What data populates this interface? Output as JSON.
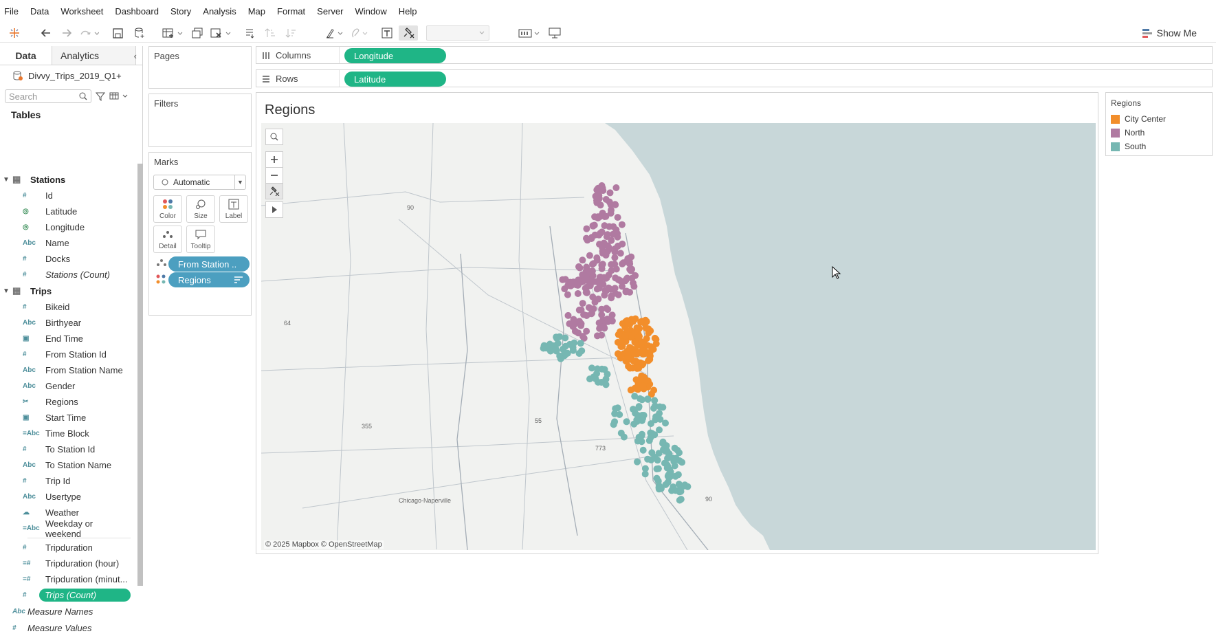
{
  "menu": [
    "File",
    "Data",
    "Worksheet",
    "Dashboard",
    "Story",
    "Analysis",
    "Map",
    "Format",
    "Server",
    "Window",
    "Help"
  ],
  "toolbar": {
    "show_me": "Show Me"
  },
  "datapane": {
    "tab_data": "Data",
    "tab_analytics": "Analytics",
    "datasource": "Divvy_Trips_2019_Q1+",
    "search_placeholder": "Search",
    "tables_heading": "Tables",
    "tables": [
      {
        "name": "Stations",
        "fields": [
          {
            "icon": "#",
            "name": "Id"
          },
          {
            "icon": "globe",
            "name": "Latitude"
          },
          {
            "icon": "globe",
            "name": "Longitude"
          },
          {
            "icon": "Abc",
            "name": "Name"
          },
          {
            "icon": "#",
            "name": "Docks"
          },
          {
            "icon": "#",
            "name": "Stations (Count)",
            "italic": true
          }
        ]
      },
      {
        "name": "Trips",
        "fields": [
          {
            "icon": "#",
            "name": "Bikeid"
          },
          {
            "icon": "Abc",
            "name": "Birthyear"
          },
          {
            "icon": "cal",
            "name": "End Time"
          },
          {
            "icon": "#",
            "name": "From Station Id"
          },
          {
            "icon": "Abc",
            "name": "From Station Name"
          },
          {
            "icon": "Abc",
            "name": "Gender"
          },
          {
            "icon": "clip",
            "name": "Regions"
          },
          {
            "icon": "cal",
            "name": "Start Time"
          },
          {
            "icon": "=Abc",
            "name": "Time Block"
          },
          {
            "icon": "#",
            "name": "To Station Id"
          },
          {
            "icon": "Abc",
            "name": "To Station Name"
          },
          {
            "icon": "#",
            "name": "Trip Id"
          },
          {
            "icon": "Abc",
            "name": "Usertype"
          },
          {
            "icon": "cloud",
            "name": "Weather"
          },
          {
            "icon": "=Abc",
            "name": "Weekday or weekend"
          },
          {
            "icon": "#",
            "name": "Tripduration",
            "sep_before": true
          },
          {
            "icon": "=#",
            "name": "Tripduration (hour)"
          },
          {
            "icon": "=#",
            "name": "Tripduration (minut..."
          },
          {
            "icon": "#",
            "name": "Trips (Count)",
            "italic": true,
            "selected": true
          }
        ]
      }
    ],
    "measures": [
      {
        "icon": "Abc",
        "name": "Measure Names"
      },
      {
        "icon": "#",
        "name": "Measure Values"
      }
    ]
  },
  "pages": {
    "title": "Pages"
  },
  "filters": {
    "title": "Filters"
  },
  "marks": {
    "title": "Marks",
    "type": "Automatic",
    "buttons": [
      "Color",
      "Size",
      "Label",
      "Detail",
      "Tooltip"
    ],
    "pills": [
      {
        "label": "From Station .."
      },
      {
        "label": "Regions"
      }
    ]
  },
  "shelves": {
    "columns_label": "Columns",
    "columns_pill": "Longitude",
    "rows_label": "Rows",
    "rows_pill": "Latitude"
  },
  "viz": {
    "title": "Regions",
    "copyright": "© 2025 Mapbox © OpenStreetMap",
    "map_labels": [
      "90",
      "64",
      "55",
      "355",
      "773",
      "Chicago-Naperville",
      "90"
    ]
  },
  "legend": {
    "title": "Regions",
    "items": [
      {
        "label": "City Center",
        "color": "#f28e2b"
      },
      {
        "label": "North",
        "color": "#b07aa1"
      },
      {
        "label": "South",
        "color": "#76b7b2"
      }
    ]
  },
  "colors": {
    "north": "#b07aa1",
    "city_center": "#f28e2b",
    "south": "#76b7b2",
    "water": "#c8d7d9",
    "pill_blue": "#4c9fc0",
    "pill_green": "#1fb586"
  }
}
